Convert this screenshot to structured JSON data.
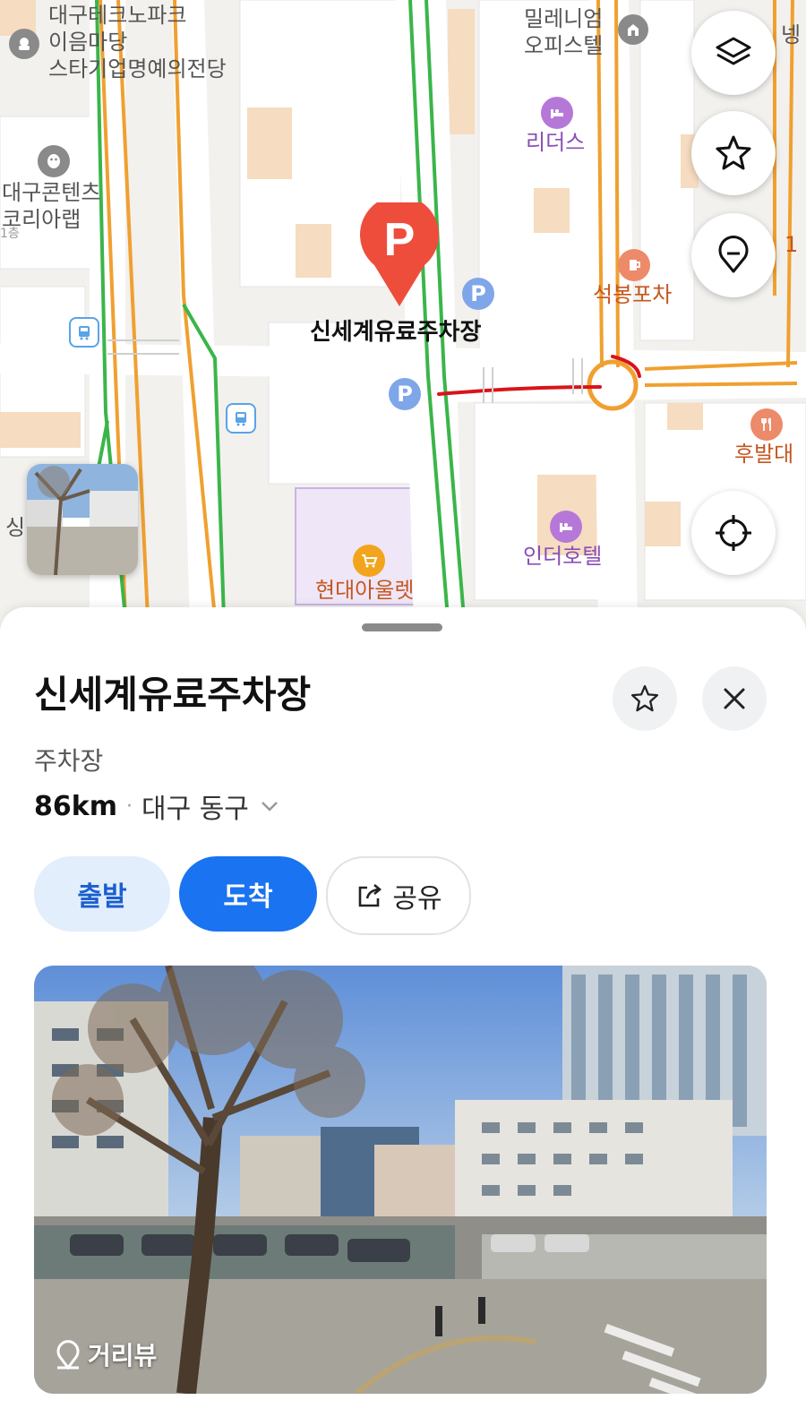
{
  "map": {
    "labels": {
      "techno_park": "대구테크노파크\n이음마당\n스타기업명예의전당",
      "content_lab": "대구콘텐츠\n코리아랩",
      "millennium": "밀레니엄\n오피스텔",
      "leaders": "리더스",
      "seokbong": "석봉포차",
      "hubal": "후발대",
      "inder_hotel": "인더호텔",
      "hyundai_outlet": "현대아울렛",
      "selected_place": "신세계유료주차장",
      "edge_left": "싱",
      "edge_right_top": "넹",
      "edge_right_mid": "1",
      "edge_left_small": "1층"
    },
    "marker_letter": "P",
    "parking_letter": "P",
    "colors": {
      "marker_red": "#ef4d3c",
      "parking_blue": "#7fa6e8",
      "road_orange": "#f0a030",
      "road_green": "#3bb54a",
      "annotation_red": "#d9141a"
    }
  },
  "sheet": {
    "title": "신세계유료주차장",
    "category": "주차장",
    "distance": "86km",
    "separator": "·",
    "address": "대구 동구",
    "buttons": {
      "depart": "출발",
      "arrive": "도착",
      "share": "공유"
    },
    "photo_label": "거리뷰",
    "colors": {
      "primary": "#1a73f0",
      "depart_bg": "#e3eefc",
      "depart_text": "#1a5fd0"
    }
  }
}
